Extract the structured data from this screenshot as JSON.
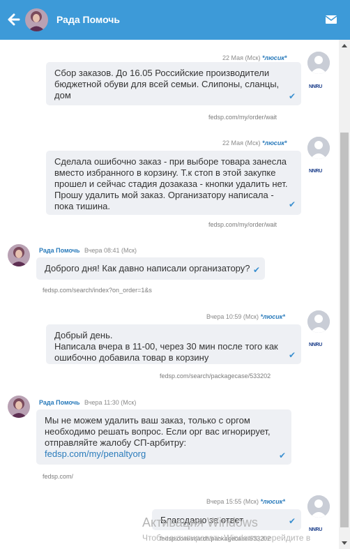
{
  "header": {
    "contact_name": "Рада Помочь"
  },
  "messages": [
    {
      "date": "22 Мая (Мск)",
      "author": "*люсик*",
      "text": "Сбор заказов. До 16.05 Российские производители бюджетной обуви для всей семьи. Слипоны, сланцы, дом",
      "link": "fedsp.com/my/order/wait",
      "brand": "NNRU"
    },
    {
      "date": "22 Мая (Мск)",
      "author": "*люсик*",
      "text": "Сделала ошибочно заказ - при выборе товара занесла вместо избранного в корзину. Т.к стоп в этой закупке прошел и сейчас стадия дозаказа - кнопки удалить нет. Прошу удалить мой заказ. Организатору написала - пока тишина.",
      "link": "fedsp.com/my/order/wait",
      "brand": "NNRU"
    },
    {
      "author": "Рада Помочь",
      "date": "Вчера 08:41 (Мск)",
      "text": "Доброго дня! Как давно написали организатору?",
      "link": "fedsp.com/search/index?on_order=1&s"
    },
    {
      "date": "Вчера 10:59 (Мск)",
      "author": "*люсик*",
      "text_line1": "Добрый день.",
      "text_line2": "Написала вчера в 11-00, через 30 мин после того как ошибочно добавила товар в корзину",
      "link": "fedsp.com/search/packagecase/533202",
      "brand": "NNRU"
    },
    {
      "author": "Рада Помочь",
      "date": "Вчера 11:30 (Мск)",
      "text": "Мы не можем удалить ваш заказ, только с оргом необходимо решать вопрос. Если орг вас игнорирует, отправляйте жалобу СП-арбитру:",
      "text_link": "fedsp.com/my/penaltyorg",
      "link": "fedsp.com/"
    },
    {
      "date": "Вчера 15:55 (Мск)",
      "author": "*люсик*",
      "text": "Благодарю за ответ",
      "link": "fedsp.com/search/packagecase/533202",
      "brand": "NNRU"
    }
  ],
  "watermark": {
    "line1": "Активация Windows",
    "line2": "Чтобы активировать Windows, перейдите в"
  },
  "colors": {
    "header": "#3d9ad8",
    "bubble": "#eef0f4",
    "accent": "#2a7bbb"
  },
  "icons": {
    "back": "arrow-left-icon",
    "mail": "envelope-icon",
    "check": "check-icon"
  }
}
